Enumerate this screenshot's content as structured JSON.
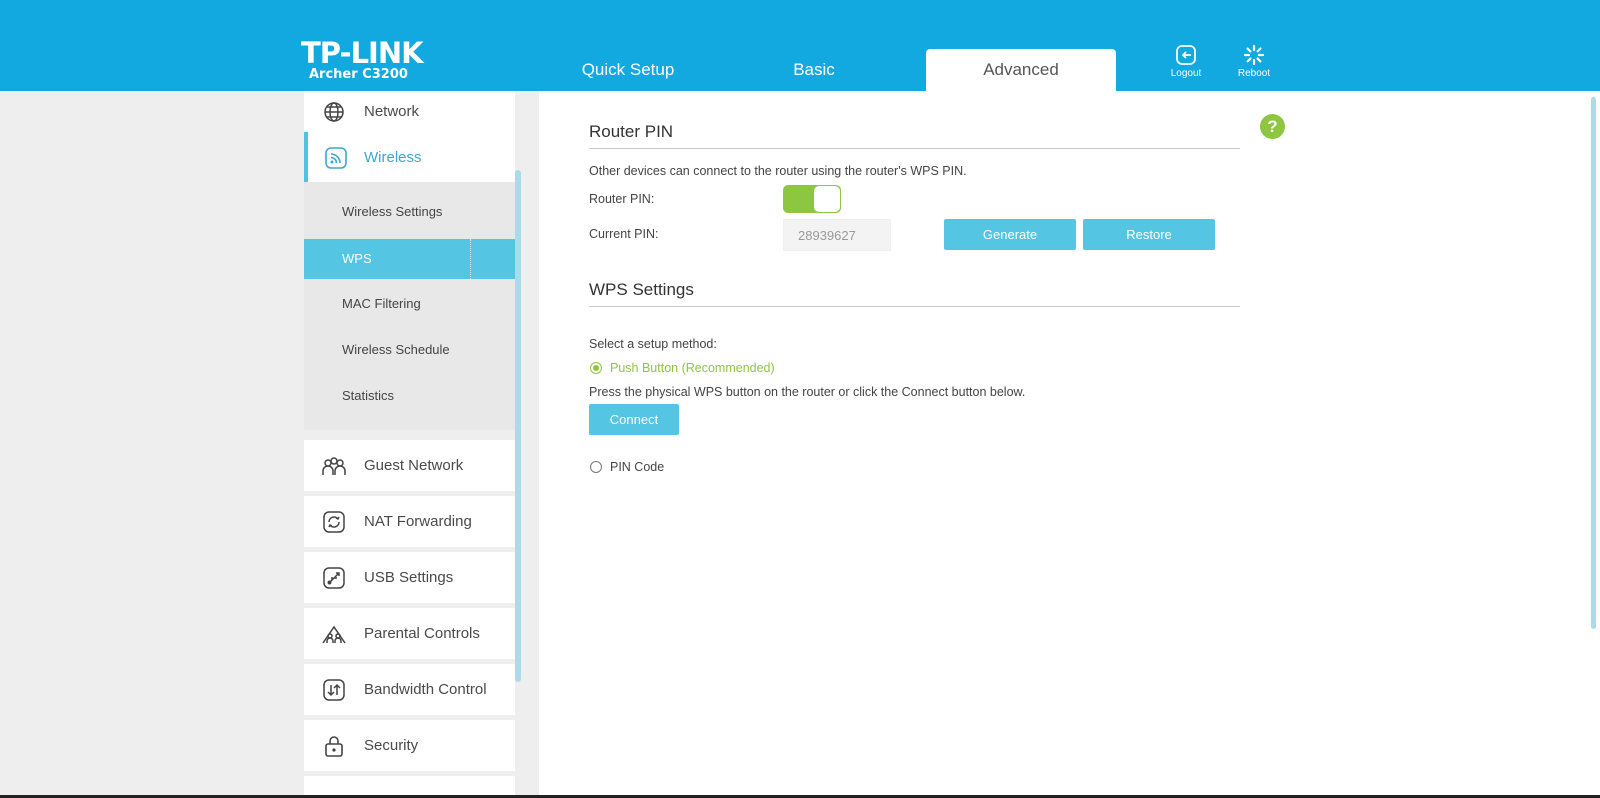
{
  "brand": {
    "logo": "TP-LINK",
    "model": "Archer C3200"
  },
  "tabs": [
    {
      "label": "Quick Setup"
    },
    {
      "label": "Basic"
    },
    {
      "label": "Advanced"
    }
  ],
  "header_buttons": {
    "logout": "Logout",
    "reboot": "Reboot"
  },
  "sidebar": {
    "items": [
      {
        "label": "Network",
        "icon": "globe-icon"
      },
      {
        "label": "Wireless",
        "icon": "wireless-icon"
      },
      {
        "label": "Guest Network",
        "icon": "guest-network-icon"
      },
      {
        "label": "NAT Forwarding",
        "icon": "nat-forwarding-icon"
      },
      {
        "label": "USB Settings",
        "icon": "usb-icon"
      },
      {
        "label": "Parental Controls",
        "icon": "parental-controls-icon"
      },
      {
        "label": "Bandwidth Control",
        "icon": "bandwidth-icon"
      },
      {
        "label": "Security",
        "icon": "lock-icon"
      }
    ],
    "wireless_sub": [
      {
        "label": "Wireless Settings"
      },
      {
        "label": "WPS"
      },
      {
        "label": "MAC Filtering"
      },
      {
        "label": "Wireless Schedule"
      },
      {
        "label": "Statistics"
      }
    ]
  },
  "router_pin": {
    "title": "Router PIN",
    "description": "Other devices can connect to the router using the router's WPS PIN.",
    "pin_label": "Router PIN:",
    "pin_enabled": true,
    "current_pin_label": "Current PIN:",
    "current_pin": "28939627",
    "generate_label": "Generate",
    "restore_label": "Restore"
  },
  "wps_settings": {
    "title": "WPS Settings",
    "method_label": "Select a setup method:",
    "push_button_label": "Push Button (Recommended)",
    "push_button_desc": "Press the physical WPS button on the router or click the Connect button below.",
    "connect_label": "Connect",
    "pin_code_label": "PIN Code",
    "selected_method": "push-button"
  },
  "colors": {
    "header": "#12a9e0",
    "accent": "#54c5e3",
    "toggle_on": "#8dc63f"
  }
}
